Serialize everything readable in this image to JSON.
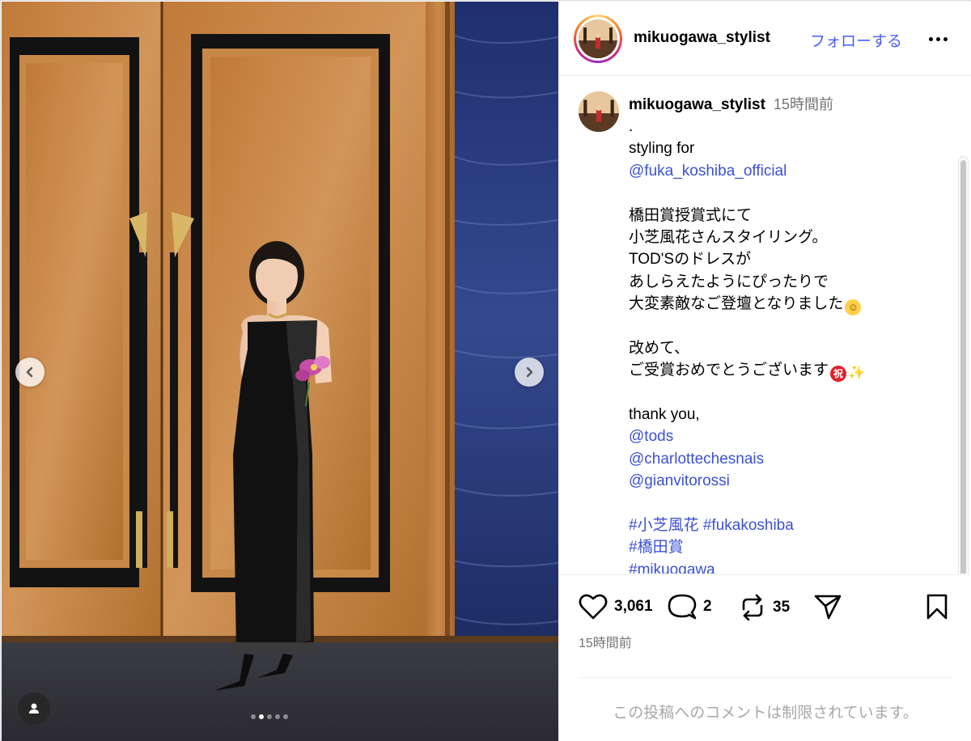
{
  "post": {
    "author": "mikuogawa_stylist",
    "follow_label": "フォローする",
    "time_ago": "15時間前",
    "caption_lines": [
      {
        "text": ".",
        "type": "text"
      },
      {
        "text": "styling for",
        "type": "text"
      },
      {
        "text": "@fuka_koshiba_official",
        "type": "link"
      },
      {
        "text": "",
        "type": "blank"
      },
      {
        "text": "橋田賞授賞式にて",
        "type": "text"
      },
      {
        "text": "小芝風花さんスタイリング。",
        "type": "text"
      },
      {
        "text": "TOD'Sのドレスが",
        "type": "text"
      },
      {
        "text": "あしらえたようにぴったりで",
        "type": "text"
      },
      {
        "text": "大変素敵なご登壇となりました",
        "type": "text",
        "emoji": [
          "relieved-face"
        ]
      },
      {
        "text": "",
        "type": "blank"
      },
      {
        "text": "改めて、",
        "type": "text"
      },
      {
        "text": "ご受賞おめでとうございます",
        "type": "text",
        "emoji": [
          "iwai-celebration",
          "sparkles"
        ]
      },
      {
        "text": "",
        "type": "blank"
      },
      {
        "text": "thank you,",
        "type": "text"
      },
      {
        "text": "@tods",
        "type": "link"
      },
      {
        "text": "@charlottechesnais",
        "type": "link"
      },
      {
        "text": "@gianvitorossi",
        "type": "link"
      },
      {
        "text": "",
        "type": "blank"
      },
      {
        "text": "#小芝風花 #fukakoshiba",
        "type": "link"
      },
      {
        "text": "#橋田賞",
        "type": "link"
      },
      {
        "text": "#mikuogawa",
        "type": "link"
      }
    ],
    "likes": "3,061",
    "comments": "2",
    "reposts": "35",
    "comments_disabled_text": "この投稿へのコメントは制限されています。",
    "emoji_glyphs": {
      "iwai-celebration": "祝",
      "sparkles": "✨",
      "relieved-face": "☺"
    }
  },
  "media": {
    "carousel": {
      "count": 5,
      "active_index": 1
    },
    "icons": {
      "prev": "chevron-left-icon",
      "next": "chevron-right-icon",
      "tags": "user-tag-icon"
    }
  },
  "colors": {
    "link": "#3b50d6",
    "follow": "#4a5df9",
    "muted": "#737373",
    "door_wood": "#b77838",
    "wall_blue": "#2b3f86"
  }
}
